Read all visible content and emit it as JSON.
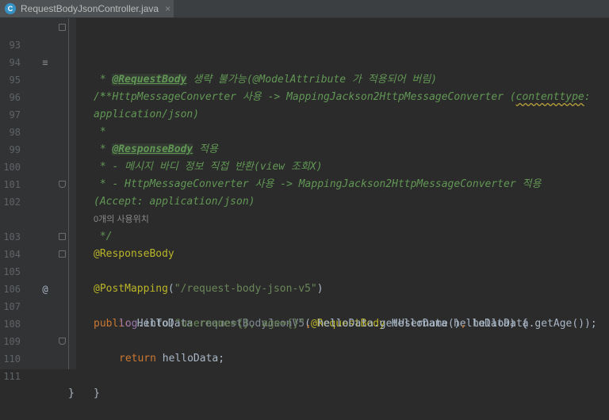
{
  "tab": {
    "icon_letter": "C",
    "filename": "RequestBodyJsonController.java",
    "close_glyph": "×"
  },
  "lines": {
    "93": "93",
    "94": "94",
    "95": "95",
    "96": "96",
    "97": "97",
    "98": "98",
    "99": "99",
    "100": "100",
    "101": "101",
    "102": "102",
    "103": "103",
    "104": "104",
    "105": "105",
    "106": "106",
    "107": "107",
    "108": "108",
    "109": "109",
    "110": "110",
    "111": "111"
  },
  "gutter": {
    "doc_icon": "≡",
    "override_icon": "@"
  },
  "code": {
    "l93": "/**",
    "l94_star": " * ",
    "l94_ann": "@RequestBody",
    "l94_rest": " 생략 불가능(@ModelAttribute 가 적용되어 버림)",
    "l95_pre": " * HttpMessageConverter 사용 -> MappingJackson2HttpMessageConverter (",
    "l95_err": "contenttype",
    "l95_post": ":",
    "l96": "application/json)",
    "l97": " *",
    "l98_star": " * ",
    "l98_ann": "@ResponseBody",
    "l98_rest": " 적용",
    "l99": " * - 메시지 바디 정보 직접 반환(view 조회X)",
    "l100": " * - HttpMessageConverter 사용 -> MappingJackson2HttpMessageConverter 적용",
    "l101": "(Accept: application/json)",
    "l102": " */",
    "usage_hint": "0개의 사용위치",
    "l103": "@ResponseBody",
    "l104_ann": "@PostMapping",
    "l104_p1": "(",
    "l104_str": "\"/request-body-json-v5\"",
    "l104_p2": ")",
    "l105_kw": "public",
    "l105_type": " HelloData ",
    "l105_name": "requestBodyJsonV5",
    "l105_p1": "(",
    "l105_ann": "@RequestBody",
    "l105_rest": " HelloData helloData) {",
    "l107_fld": "log",
    "l107_dot": ".info(",
    "l107_str": "\"username={}, age={}\"",
    "l107_c1": ", ",
    "l107_call1": "helloData.getUsername()",
    "l107_c2": ", ",
    "l107_call2": "helloData.getAge());",
    "l109_kw": "return",
    "l109_rest": " helloData;",
    "l110": "}",
    "l111": "}"
  }
}
